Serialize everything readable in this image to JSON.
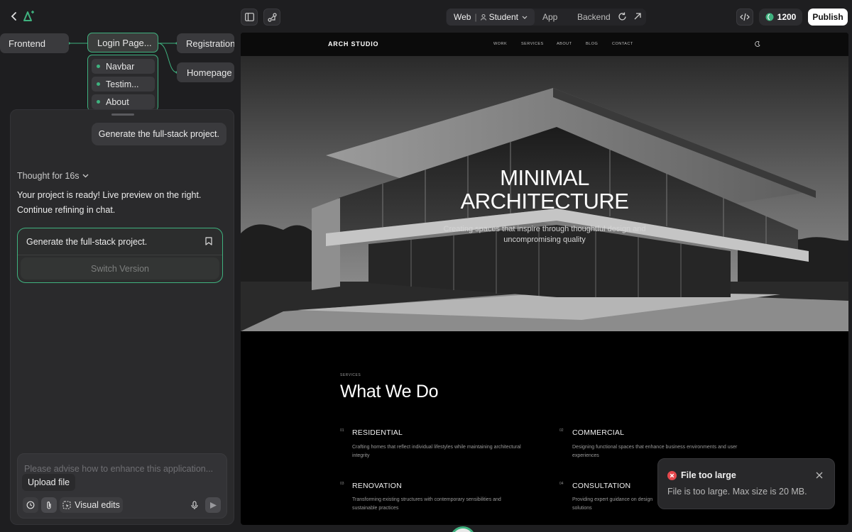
{
  "topbar": {
    "tabs": {
      "web": "Web",
      "student": "Student",
      "app": "App",
      "backend": "Backend"
    },
    "credits": "1200",
    "publish": "Publish",
    "accent": "#3fb27f"
  },
  "flow": {
    "frontend": "Frontend",
    "login": "Login Page...",
    "registration": "Registration.",
    "homepage": "Homepage",
    "sub": [
      "Navbar",
      "Testim...",
      "About"
    ]
  },
  "chat": {
    "user_message": "Generate the full-stack project.",
    "thought": "Thought for 16s",
    "reply_line1": "Your project is ready! Live preview on the right.",
    "reply_line2": "Continue refining in chat.",
    "version_title": "Generate the full-stack project.",
    "switch_version": "Switch Version",
    "input_placeholder": "Please advise how to enhance this application...",
    "upload_file": "Upload file",
    "visual_edits": "Visual edits"
  },
  "site": {
    "brand": "ARCH STUDIO",
    "nav": [
      "WORK",
      "SERVICES",
      "ABOUT",
      "BLOG",
      "CONTACT"
    ],
    "hero_title_1": "MINIMAL",
    "hero_title_2": "ARCHITECTURE",
    "hero_sub_1": "Creating spaces that inspire through thoughtful design and",
    "hero_sub_2": "uncompromising quality",
    "services_label": "SERVICES",
    "section_title": "What We Do",
    "services": [
      {
        "num": "01",
        "title": "RESIDENTIAL",
        "desc1": "Crafting homes that reflect individual lifestyles while maintaining architectural",
        "desc2": "integrity"
      },
      {
        "num": "02",
        "title": "COMMERCIAL",
        "desc1": "Designing functional spaces that enhance business environments and user",
        "desc2": "experiences"
      },
      {
        "num": "03",
        "title": "RENOVATION",
        "desc1": "Transforming existing structures with contemporary sensibilities and",
        "desc2": "sustainable practices"
      },
      {
        "num": "04",
        "title": "CONSULTATION",
        "desc1": "Providing expert guidance on design",
        "desc2": "solutions"
      }
    ]
  },
  "toast": {
    "title": "File too large",
    "message": "File is too large. Max size is 20 MB.",
    "color": "#e5484d"
  }
}
